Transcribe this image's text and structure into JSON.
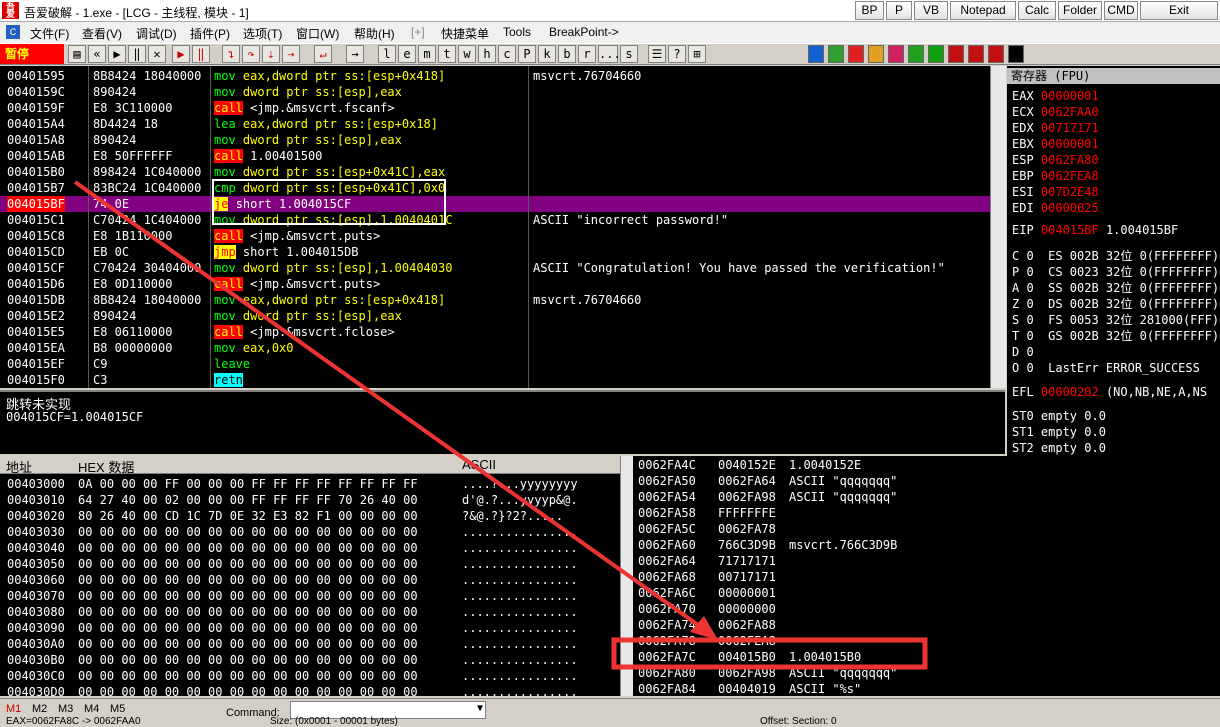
{
  "window": {
    "title": "吾爱破解 - 1.exe - [LCG - 主线程, 模块 - 1]",
    "app_icon_text": "吾爱",
    "title_buttons": [
      "BP",
      "P",
      "VB",
      "Notepad",
      "Calc",
      "Folder",
      "CMD",
      "Exit"
    ]
  },
  "menu": {
    "items": [
      "文件(F)",
      "查看(V)",
      "调试(D)",
      "插件(P)",
      "选项(T)",
      "窗口(W)",
      "帮助(H)",
      "[+]",
      "快捷菜单",
      "Tools",
      "BreakPoint->"
    ]
  },
  "toolbar": {
    "status": "暂停",
    "letter_buttons": [
      "l",
      "e",
      "m",
      "t",
      "w",
      "h",
      "c",
      "P",
      "k",
      "b",
      "r",
      "...",
      "s"
    ],
    "color_buttons": [
      "#1060d0",
      "#30a030",
      "#e02020",
      "#e0a020",
      "#d02060",
      "#20a020",
      "#10a010",
      "#c01010",
      "#c01010",
      "#c01010",
      "#000000"
    ]
  },
  "cpu": {
    "rows": [
      {
        "addr": "00401595",
        "hex": "8B8424 18040000",
        "ins": "mov",
        "ops": "eax,dword ptr ss:[esp+0x418]",
        "com": "msvcrt.76704660",
        "kind": "mov"
      },
      {
        "addr": "0040159C",
        "hex": "890424",
        "ins": "mov",
        "ops": "dword ptr ss:[esp],eax",
        "com": "",
        "kind": "mov"
      },
      {
        "addr": "0040159F",
        "hex": "E8 3C110000",
        "ins": "call",
        "ops": "<jmp.&msvcrt.fscanf>",
        "com": "",
        "kind": "call"
      },
      {
        "addr": "004015A4",
        "hex": "8D4424 18",
        "ins": "lea",
        "ops": "eax,dword ptr ss:[esp+0x18]",
        "com": "",
        "kind": "mov"
      },
      {
        "addr": "004015A8",
        "hex": "890424",
        "ins": "mov",
        "ops": "dword ptr ss:[esp],eax",
        "com": "",
        "kind": "mov"
      },
      {
        "addr": "004015AB",
        "hex": "E8 50FFFFFF",
        "ins": "call",
        "ops": "1.00401500",
        "com": "",
        "kind": "call"
      },
      {
        "addr": "004015B0",
        "hex": "898424 1C040000",
        "ins": "mov",
        "ops": "dword ptr ss:[esp+0x41C],eax",
        "com": "",
        "kind": "mov"
      },
      {
        "addr": "004015B7",
        "hex": "83BC24 1C040000",
        "ins": "cmp",
        "ops": "dword ptr ss:[esp+0x41C],0x0",
        "com": "",
        "kind": "mov"
      },
      {
        "addr": "004015BF",
        "hex": "74 0E",
        "ins": "je",
        "ops": "short 1.004015CF",
        "com": "",
        "kind": "jmp"
      },
      {
        "addr": "004015C1",
        "hex": "C70424 1C404000",
        "ins": "mov",
        "ops": "dword ptr ss:[esp],1.0040401C",
        "com": "ASCII \"incorrect password!\"",
        "kind": "mov"
      },
      {
        "addr": "004015C8",
        "hex": "E8 1B110000",
        "ins": "call",
        "ops": "<jmp.&msvcrt.puts>",
        "com": "",
        "kind": "call"
      },
      {
        "addr": "004015CD",
        "hex": "EB 0C",
        "ins": "jmp",
        "ops": "short 1.004015DB",
        "com": "",
        "kind": "jmp"
      },
      {
        "addr": "004015CF",
        "hex": "C70424 30404000",
        "ins": "mov",
        "ops": "dword ptr ss:[esp],1.00404030",
        "com": "ASCII \"Congratulation! You have passed the verification!\"",
        "kind": "mov"
      },
      {
        "addr": "004015D6",
        "hex": "E8 0D110000",
        "ins": "call",
        "ops": "<jmp.&msvcrt.puts>",
        "com": "",
        "kind": "call"
      },
      {
        "addr": "004015DB",
        "hex": "8B8424 18040000",
        "ins": "mov",
        "ops": "eax,dword ptr ss:[esp+0x418]",
        "com": "msvcrt.76704660",
        "kind": "mov"
      },
      {
        "addr": "004015E2",
        "hex": "890424",
        "ins": "mov",
        "ops": "dword ptr ss:[esp],eax",
        "com": "",
        "kind": "mov"
      },
      {
        "addr": "004015E5",
        "hex": "E8 06110000",
        "ins": "call",
        "ops": "<jmp.&msvcrt.fclose>",
        "com": "",
        "kind": "call"
      },
      {
        "addr": "004015EA",
        "hex": "B8 00000000",
        "ins": "mov",
        "ops": "eax,0x0",
        "com": "",
        "kind": "mov"
      },
      {
        "addr": "004015EF",
        "hex": "C9",
        "ins": "leave",
        "ops": "",
        "com": "",
        "kind": "mov"
      },
      {
        "addr": "004015F0",
        "hex": "C3",
        "ins": "retn",
        "ops": "",
        "com": "",
        "kind": "ret"
      }
    ],
    "selected_index": 8
  },
  "info": {
    "line1": "跳转未实现",
    "line2": "004015CF=1.004015CF"
  },
  "registers": {
    "title": "寄存器 (FPU)",
    "gp": [
      {
        "name": "EAX",
        "val": "00000001",
        "com": ""
      },
      {
        "name": "ECX",
        "val": "0062FAA0",
        "com": ""
      },
      {
        "name": "EDX",
        "val": "00717171",
        "com": ""
      },
      {
        "name": "EBX",
        "val": "00000001",
        "com": ""
      },
      {
        "name": "ESP",
        "val": "0062FA80",
        "com": ""
      },
      {
        "name": "EBP",
        "val": "0062FEA8",
        "com": ""
      },
      {
        "name": "ESI",
        "val": "007D2E48",
        "com": ""
      },
      {
        "name": "EDI",
        "val": "00000025",
        "com": ""
      }
    ],
    "eip": {
      "name": "EIP",
      "val": "004015BF",
      "com": "1.004015BF"
    },
    "flags": [
      "C 0  ES 002B 32位 0(FFFFFFFF)",
      "P 0  CS 0023 32位 0(FFFFFFFF)",
      "A 0  SS 002B 32位 0(FFFFFFFF)",
      "Z 0  DS 002B 32位 0(FFFFFFFF)",
      "S 0  FS 0053 32位 281000(FFF)",
      "T 0  GS 002B 32位 0(FFFFFFFF)",
      "D 0",
      "O 0  LastErr ERROR_SUCCESS"
    ],
    "efl": {
      "name": "EFL",
      "val": "00000202",
      "com": "(NO,NB,NE,A,NS"
    },
    "fpu": [
      "ST0 empty 0.0",
      "ST1 empty 0.0",
      "ST2 empty 0.0"
    ]
  },
  "dump": {
    "header": {
      "addr": "地址",
      "hex": "HEX 数据",
      "ascii": "ASCII"
    },
    "rows": [
      {
        "addr": "00403000",
        "hex": "0A 00 00 00 FF 00 00 00 FF FF FF FF FF FF FF FF",
        "asc": "....?...yyyyyyyy"
      },
      {
        "addr": "00403010",
        "hex": "64 27 40 00 02 00 00 00 FF FF FF FF 70 26 40 00",
        "asc": "d'@.?...yyyyp&@."
      },
      {
        "addr": "00403020",
        "hex": "80 26 40 00 CD 1C 7D 0E 32 E3 82 F1 00 00 00 00",
        "asc": "?&@.?}?2?....."
      },
      {
        "addr": "00403030",
        "hex": "00 00 00 00 00 00 00 00 00 00 00 00 00 00 00 00",
        "asc": "................"
      },
      {
        "addr": "00403040",
        "hex": "00 00 00 00 00 00 00 00 00 00 00 00 00 00 00 00",
        "asc": "................"
      },
      {
        "addr": "00403050",
        "hex": "00 00 00 00 00 00 00 00 00 00 00 00 00 00 00 00",
        "asc": "................"
      },
      {
        "addr": "00403060",
        "hex": "00 00 00 00 00 00 00 00 00 00 00 00 00 00 00 00",
        "asc": "................"
      },
      {
        "addr": "00403070",
        "hex": "00 00 00 00 00 00 00 00 00 00 00 00 00 00 00 00",
        "asc": "................"
      },
      {
        "addr": "00403080",
        "hex": "00 00 00 00 00 00 00 00 00 00 00 00 00 00 00 00",
        "asc": "................"
      },
      {
        "addr": "00403090",
        "hex": "00 00 00 00 00 00 00 00 00 00 00 00 00 00 00 00",
        "asc": "................"
      },
      {
        "addr": "004030A0",
        "hex": "00 00 00 00 00 00 00 00 00 00 00 00 00 00 00 00",
        "asc": "................"
      },
      {
        "addr": "004030B0",
        "hex": "00 00 00 00 00 00 00 00 00 00 00 00 00 00 00 00",
        "asc": "................"
      },
      {
        "addr": "004030C0",
        "hex": "00 00 00 00 00 00 00 00 00 00 00 00 00 00 00 00",
        "asc": "................"
      },
      {
        "addr": "004030D0",
        "hex": "00 00 00 00 00 00 00 00 00 00 00 00 00 00 00 00",
        "asc": "................"
      }
    ]
  },
  "stack": {
    "rows": [
      {
        "addr": "0062FA4C",
        "val": "0040152E",
        "com": "1.0040152E"
      },
      {
        "addr": "0062FA50",
        "val": "0062FA64",
        "com": "ASCII \"qqqqqqq\""
      },
      {
        "addr": "0062FA54",
        "val": "0062FA98",
        "com": "ASCII \"qqqqqqq\""
      },
      {
        "addr": "0062FA58",
        "val": "FFFFFFFE",
        "com": ""
      },
      {
        "addr": "0062FA5C",
        "val": "0062FA78",
        "com": ""
      },
      {
        "addr": "0062FA60",
        "val": "766C3D9B",
        "com": "msvcrt.766C3D9B"
      },
      {
        "addr": "0062FA64",
        "val": "71717171",
        "com": ""
      },
      {
        "addr": "0062FA68",
        "val": "00717171",
        "com": ""
      },
      {
        "addr": "0062FA6C",
        "val": "00000001",
        "com": ""
      },
      {
        "addr": "0062FA70",
        "val": "00000000",
        "com": ""
      },
      {
        "addr": "0062FA74",
        "val": "0062FA88",
        "com": ""
      },
      {
        "addr": "0062FA78",
        "val": "0062FEA8",
        "com": ""
      },
      {
        "addr": "0062FA7C",
        "val": "004015B0",
        "com": "1.004015B0"
      },
      {
        "addr": "0062FA80",
        "val": "0062FA98",
        "com": "ASCII \"qqqqqqq\""
      },
      {
        "addr": "0062FA84",
        "val": "00404019",
        "com": "ASCII \"%s\""
      }
    ]
  },
  "statusbar": {
    "tabs": [
      "M1",
      "M2",
      "M3",
      "M4",
      "M5"
    ],
    "command_label": "Command:",
    "left_text": "EAX=0062FA8C -> 0062FAA0",
    "mid_text": "Size: (0x0001 - 00001 bytes)",
    "right_text": "Offset: Section: 0"
  },
  "colors": {
    "pause_bg": "#ff0000",
    "selected_row": "#800080",
    "annotation": "#ee3333"
  }
}
